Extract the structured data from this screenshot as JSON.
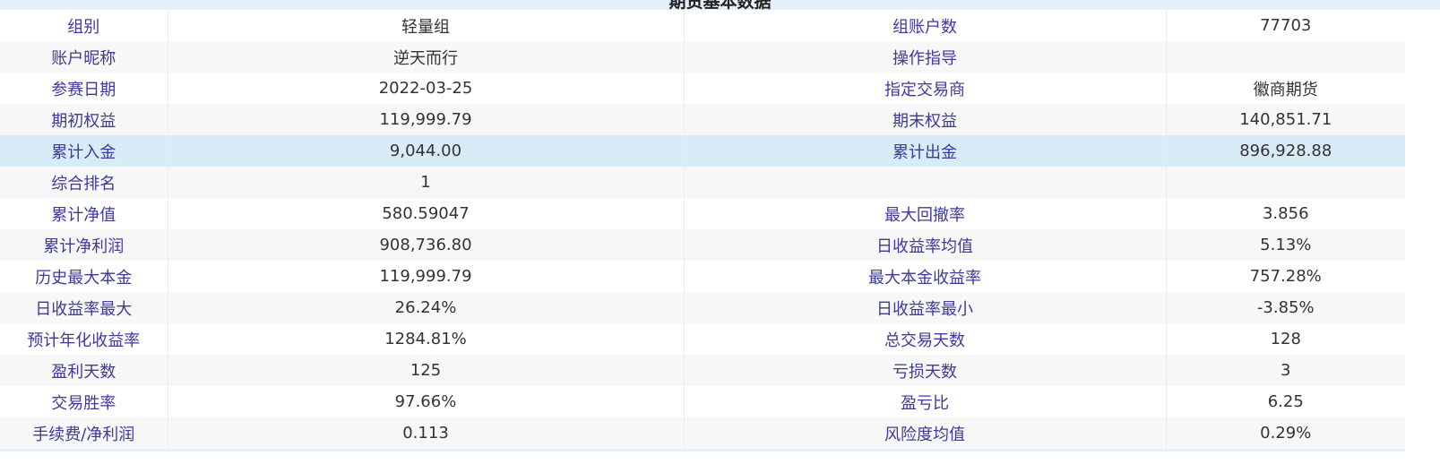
{
  "header": {
    "title_partial": "期货基本数据"
  },
  "rows": [
    {
      "label1": "组别",
      "value1": "轻量组",
      "label2": "组账户数",
      "value2": "77703"
    },
    {
      "label1": "账户昵称",
      "value1": "逆天而行",
      "label2": "操作指导",
      "value2": ""
    },
    {
      "label1": "参赛日期",
      "value1": "2022-03-25",
      "label2": "指定交易商",
      "value2": "徽商期货"
    },
    {
      "label1": "期初权益",
      "value1": "119,999.79",
      "label2": "期末权益",
      "value2": "140,851.71"
    },
    {
      "label1": "累计入金",
      "value1": "9,044.00",
      "label2": "累计出金",
      "value2": "896,928.88"
    },
    {
      "label1": "综合排名",
      "value1": "1",
      "label2": "",
      "value2": ""
    },
    {
      "label1": "累计净值",
      "value1": "580.59047",
      "label2": "最大回撤率",
      "value2": "3.856"
    },
    {
      "label1": "累计净利润",
      "value1": "908,736.80",
      "label2": "日收益率均值",
      "value2": "5.13%"
    },
    {
      "label1": "历史最大本金",
      "value1": "119,999.79",
      "label2": "最大本金收益率",
      "value2": "757.28%"
    },
    {
      "label1": "日收益率最大",
      "value1": "26.24%",
      "label2": "日收益率最小",
      "value2": "-3.85%"
    },
    {
      "label1": "预计年化收益率",
      "value1": "1284.81%",
      "label2": "总交易天数",
      "value2": "128"
    },
    {
      "label1": "盈利天数",
      "value1": "125",
      "label2": "亏损天数",
      "value2": "3"
    },
    {
      "label1": "交易胜率",
      "value1": "97.66%",
      "label2": "盈亏比",
      "value2": "6.25"
    },
    {
      "label1": "手续费/净利润",
      "value1": "0.113",
      "label2": "风险度均值",
      "value2": "0.29%"
    }
  ],
  "colors": {
    "label_text": "#3d3a9c",
    "value_text": "#333333",
    "highlight_row": "#d9ebf7",
    "alt_row": "#f7f7f7",
    "band": "#e4f0fb"
  }
}
